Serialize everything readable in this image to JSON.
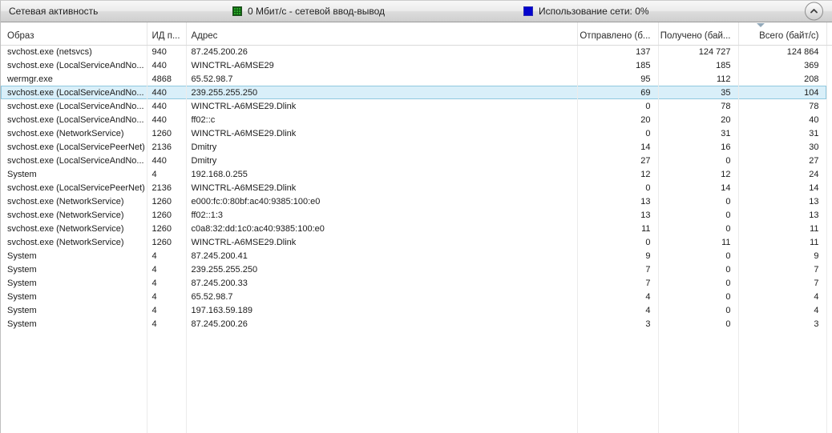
{
  "panel": {
    "title": "Сетевая активность",
    "io_legend": {
      "label": "0 Мбит/с - сетевой ввод-вывод",
      "swatch_color": "#2aa52a"
    },
    "usage_legend": {
      "label": "Использование сети: 0%",
      "swatch_color": "#0404cd"
    },
    "collapse_button": {
      "state": "expanded",
      "icon": "chevron-up-icon"
    }
  },
  "colors": {
    "selection_background": "#d9eff9",
    "selection_border": "#90c8df",
    "grid_line": "#ebebeb",
    "title_bar_border": "#9a9a9a"
  },
  "table": {
    "columns": [
      {
        "id": "image",
        "label": "Образ",
        "align": "left"
      },
      {
        "id": "pid",
        "label": "ИД п...",
        "align": "left"
      },
      {
        "id": "address",
        "label": "Адрес",
        "align": "left"
      },
      {
        "id": "sent",
        "label": "Отправлено (б...",
        "align": "right"
      },
      {
        "id": "received",
        "label": "Получено (бай...",
        "align": "right"
      },
      {
        "id": "total",
        "label": "Всего (байт/с)",
        "align": "right",
        "sorted": "desc"
      }
    ],
    "selected_row_index": 3,
    "rows": [
      [
        "svchost.exe (netsvcs)",
        "940",
        "87.245.200.26",
        "137",
        "124 727",
        "124 864"
      ],
      [
        "svchost.exe (LocalServiceAndNo...",
        "440",
        "WINCTRL-A6MSE29",
        "185",
        "185",
        "369"
      ],
      [
        "wermgr.exe",
        "4868",
        "65.52.98.7",
        "95",
        "112",
        "208"
      ],
      [
        "svchost.exe (LocalServiceAndNo...",
        "440",
        "239.255.255.250",
        "69",
        "35",
        "104"
      ],
      [
        "svchost.exe (LocalServiceAndNo...",
        "440",
        "WINCTRL-A6MSE29.Dlink",
        "0",
        "78",
        "78"
      ],
      [
        "svchost.exe (LocalServiceAndNo...",
        "440",
        "ff02::c",
        "20",
        "20",
        "40"
      ],
      [
        "svchost.exe (NetworkService)",
        "1260",
        "WINCTRL-A6MSE29.Dlink",
        "0",
        "31",
        "31"
      ],
      [
        "svchost.exe (LocalServicePeerNet)",
        "2136",
        "Dmitry",
        "14",
        "16",
        "30"
      ],
      [
        "svchost.exe (LocalServiceAndNo...",
        "440",
        "Dmitry",
        "27",
        "0",
        "27"
      ],
      [
        "System",
        "4",
        "192.168.0.255",
        "12",
        "12",
        "24"
      ],
      [
        "svchost.exe (LocalServicePeerNet)",
        "2136",
        "WINCTRL-A6MSE29.Dlink",
        "0",
        "14",
        "14"
      ],
      [
        "svchost.exe (NetworkService)",
        "1260",
        "e000:fc:0:80bf:ac40:9385:100:e0",
        "13",
        "0",
        "13"
      ],
      [
        "svchost.exe (NetworkService)",
        "1260",
        "ff02::1:3",
        "13",
        "0",
        "13"
      ],
      [
        "svchost.exe (NetworkService)",
        "1260",
        "c0a8:32:dd:1c0:ac40:9385:100:e0",
        "11",
        "0",
        "11"
      ],
      [
        "svchost.exe (NetworkService)",
        "1260",
        "WINCTRL-A6MSE29.Dlink",
        "0",
        "11",
        "11"
      ],
      [
        "System",
        "4",
        "87.245.200.41",
        "9",
        "0",
        "9"
      ],
      [
        "System",
        "4",
        "239.255.255.250",
        "7",
        "0",
        "7"
      ],
      [
        "System",
        "4",
        "87.245.200.33",
        "7",
        "0",
        "7"
      ],
      [
        "System",
        "4",
        "65.52.98.7",
        "4",
        "0",
        "4"
      ],
      [
        "System",
        "4",
        "197.163.59.189",
        "4",
        "0",
        "4"
      ],
      [
        "System",
        "4",
        "87.245.200.26",
        "3",
        "0",
        "3"
      ]
    ]
  }
}
